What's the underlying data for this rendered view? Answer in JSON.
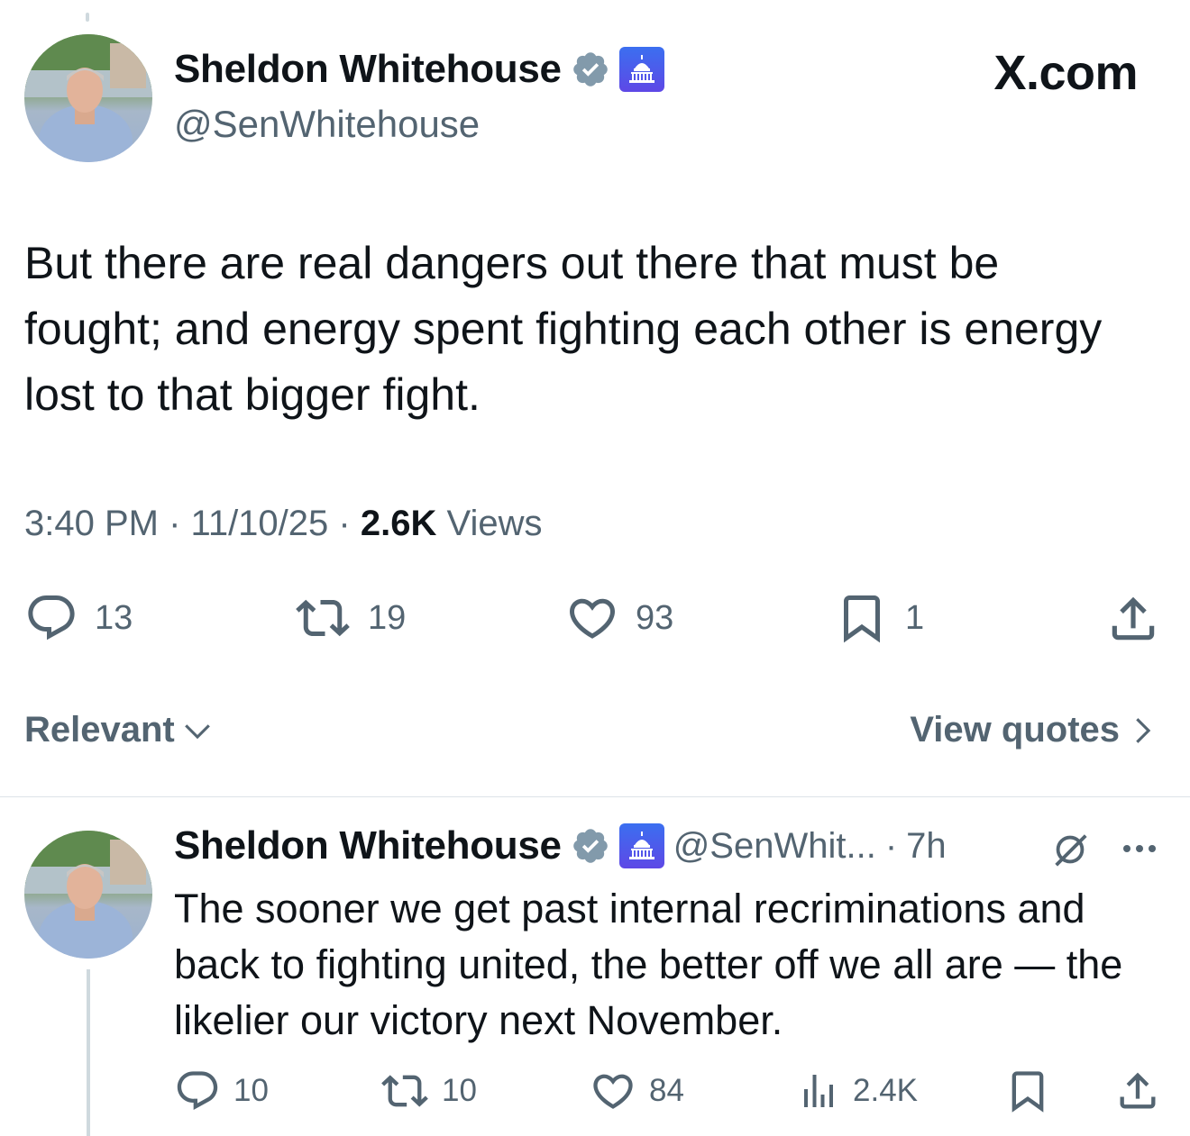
{
  "main_tweet": {
    "author_name": "Sheldon Whitehouse",
    "author_handle": "@SenWhitehouse",
    "site_label": "X.com",
    "text": "But there are real dangers out there that must be fought; and energy spent fighting each other is energy lost to that bigger fight.",
    "time": "3:40 PM",
    "date": "11/10/25",
    "views_count": "2.6K",
    "views_label": "Views",
    "sep": "·",
    "replies": "13",
    "reposts": "19",
    "likes": "93",
    "bookmarks": "1"
  },
  "sort_controls": {
    "relevant_label": "Relevant",
    "view_quotes_label": "View quotes"
  },
  "reply_tweet": {
    "author_name": "Sheldon Whitehouse",
    "author_handle": "@SenWhit...",
    "time_ago": "7h",
    "sep": "·",
    "text": "The sooner we get past internal recriminations and back to fighting united, the better off we all are — the likelier our victory next November.",
    "replies": "10",
    "reposts": "10",
    "likes": "84",
    "views": "2.4K"
  },
  "icons": {
    "verified": "verified-badge-icon",
    "government": "capitol-icon",
    "reply": "reply-icon",
    "repost": "repost-icon",
    "like": "heart-icon",
    "bookmark": "bookmark-icon",
    "share": "share-icon",
    "views": "analytics-icon",
    "grok": "grok-icon",
    "more": "more-icon"
  },
  "colors": {
    "text": "#0f1419",
    "muted": "#536471",
    "verified": "#829aab",
    "divider": "#dde3e8"
  }
}
